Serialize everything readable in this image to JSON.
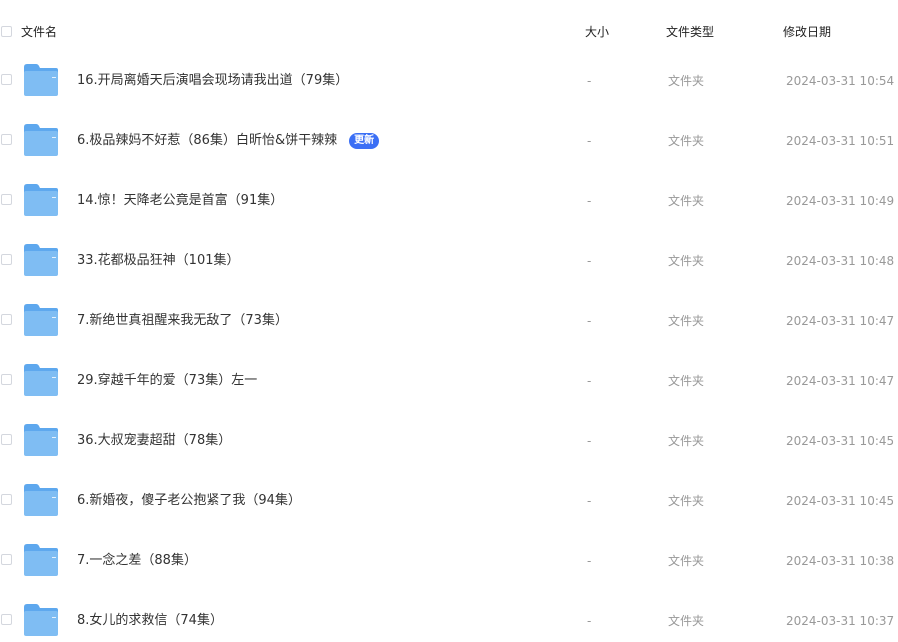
{
  "columns": {
    "name": "文件名",
    "size": "大小",
    "type": "文件类型",
    "modified": "修改日期"
  },
  "colors": {
    "folder_body": "#7fbdf3",
    "folder_tab": "#5ea8ee",
    "badge": "#3b6ff5"
  },
  "rows": [
    {
      "name": "16.开局离婚天后演唱会现场请我出道（79集）",
      "badge": "",
      "size": "-",
      "type": "文件夹",
      "modified": "2024-03-31 10:54",
      "icon": "folder-icon"
    },
    {
      "name": "6.极品辣妈不好惹（86集）白昕怡&饼干辣辣",
      "badge": "更新",
      "size": "-",
      "type": "文件夹",
      "modified": "2024-03-31 10:51",
      "icon": "folder-icon"
    },
    {
      "name": "14.惊！天降老公竟是首富（91集）",
      "badge": "",
      "size": "-",
      "type": "文件夹",
      "modified": "2024-03-31 10:49",
      "icon": "folder-icon"
    },
    {
      "name": "33.花都极品狂神（101集）",
      "badge": "",
      "size": "-",
      "type": "文件夹",
      "modified": "2024-03-31 10:48",
      "icon": "folder-icon"
    },
    {
      "name": "7.新绝世真祖醒来我无敌了（73集）",
      "badge": "",
      "size": "-",
      "type": "文件夹",
      "modified": "2024-03-31 10:47",
      "icon": "folder-icon"
    },
    {
      "name": "29.穿越千年的爱（73集）左一",
      "badge": "",
      "size": "-",
      "type": "文件夹",
      "modified": "2024-03-31 10:47",
      "icon": "folder-icon"
    },
    {
      "name": "36.大叔宠妻超甜（78集）",
      "badge": "",
      "size": "-",
      "type": "文件夹",
      "modified": "2024-03-31 10:45",
      "icon": "folder-icon"
    },
    {
      "name": "6.新婚夜，傻子老公抱紧了我（94集）",
      "badge": "",
      "size": "-",
      "type": "文件夹",
      "modified": "2024-03-31 10:45",
      "icon": "folder-icon"
    },
    {
      "name": "7.一念之差（88集）",
      "badge": "",
      "size": "-",
      "type": "文件夹",
      "modified": "2024-03-31 10:38",
      "icon": "folder-icon"
    },
    {
      "name": "8.女儿的求救信（74集）",
      "badge": "",
      "size": "-",
      "type": "文件夹",
      "modified": "2024-03-31 10:37",
      "icon": "folder-icon"
    }
  ]
}
